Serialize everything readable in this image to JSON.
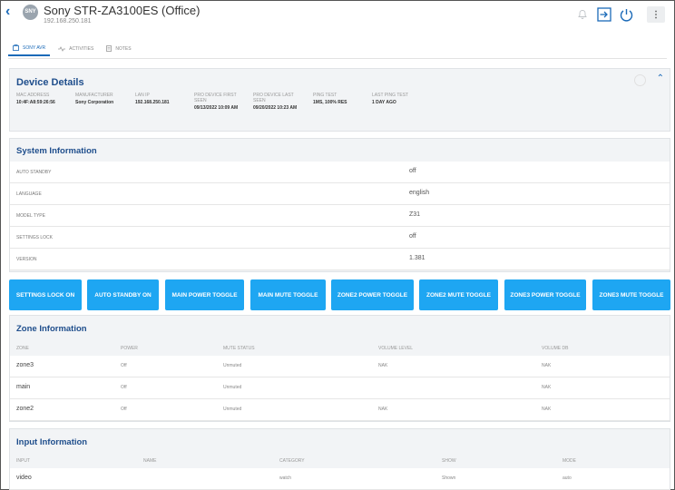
{
  "header": {
    "avatar_text": "SNY",
    "title": "Sony STR-ZA3100ES (Office)",
    "ip": "192.168.250.181",
    "more_label": "⋮"
  },
  "tabs": [
    {
      "label": "SONY AVR",
      "active": true
    },
    {
      "label": "ACTIVITIES",
      "active": false
    },
    {
      "label": "NOTES",
      "active": false
    }
  ],
  "device_details": {
    "title": "Device Details",
    "fields": [
      {
        "label": "MAC ADDRESS",
        "value": "10:4F:A8:59:26:56"
      },
      {
        "label": "MANUFACTURER",
        "value": "Sony Corporation"
      },
      {
        "label": "LAN IP",
        "value": "192.168.250.181"
      },
      {
        "label": "PRO DEVICE FIRST SEEN",
        "value": "09/13/2022 10:09 AM"
      },
      {
        "label": "PRO DEVICE LAST SEEN",
        "value": "09/20/2022 10:23 AM"
      },
      {
        "label": "PING TEST",
        "value": "1MS, 100% RES"
      },
      {
        "label": "LAST PING TEST",
        "value": "1 DAY AGO"
      }
    ]
  },
  "system_info": {
    "title": "System Information",
    "rows": [
      {
        "key": "AUTO STANDBY",
        "value": "off"
      },
      {
        "key": "LANGUAGE",
        "value": "english"
      },
      {
        "key": "MODEL TYPE",
        "value": "Z31"
      },
      {
        "key": "SETTINGS LOCK",
        "value": "off"
      },
      {
        "key": "VERSION",
        "value": "1.381"
      }
    ]
  },
  "actions": [
    {
      "label": "SETTINGS LOCK ON"
    },
    {
      "label": "AUTO STANDBY ON"
    },
    {
      "label": "MAIN POWER TOGGLE"
    },
    {
      "label": "MAIN MUTE TOGGLE"
    },
    {
      "label": "ZONE2 POWER TOGGLE"
    },
    {
      "label": "ZONE2 MUTE TOGGLE"
    },
    {
      "label": "ZONE3 POWER TOGGLE"
    },
    {
      "label": "ZONE3 MUTE TOGGLE"
    }
  ],
  "zone_info": {
    "title": "Zone Information",
    "columns": [
      "ZONE",
      "POWER",
      "MUTE STATUS",
      "VOLUME LEVEL",
      "VOLUME DB"
    ],
    "rows": [
      [
        "zone3",
        "Off",
        "Unmuted",
        "NAK",
        "NAK"
      ],
      [
        "main",
        "Off",
        "Unmuted",
        "",
        "NAK"
      ],
      [
        "zone2",
        "Off",
        "Unmuted",
        "NAK",
        "NAK"
      ]
    ]
  },
  "input_info": {
    "title": "Input Information",
    "columns": [
      "INPUT",
      "NAME",
      "CATEGORY",
      "SHOW",
      "MODE"
    ],
    "rows": [
      [
        "video",
        "",
        "watch",
        "Shown",
        "auto"
      ]
    ]
  },
  "colors": {
    "accent": "#1b6ab8",
    "button": "#1ea6f2",
    "section_title": "#1f4e8c"
  }
}
